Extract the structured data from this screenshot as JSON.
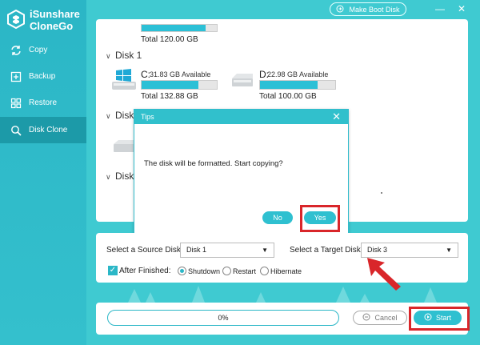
{
  "app": {
    "name_line1": "iSunshare",
    "name_line2": "CloneGo",
    "make_boot_label": "Make Boot Disk",
    "minimize_glyph": "—",
    "close_glyph": "✕"
  },
  "sidebar": {
    "items": [
      {
        "label": "Copy",
        "icon": "sync-icon"
      },
      {
        "label": "Backup",
        "icon": "backup-icon"
      },
      {
        "label": "Restore",
        "icon": "restore-icon"
      },
      {
        "label": "Disk Clone",
        "icon": "disk-clone-icon",
        "active": true
      }
    ]
  },
  "disks": {
    "top_total": "Total 120.00 GB",
    "disk1": {
      "label": "Disk 1",
      "drives": [
        {
          "letter": "C:",
          "available": "31.83 GB Available",
          "total": "Total 132.88 GB",
          "used_fraction": 0.76
        },
        {
          "letter": "D:",
          "available": "22.98 GB Available",
          "total": "Total 100.00 GB",
          "used_fraction": 0.77
        }
      ]
    },
    "disk2_label": "Disk",
    "disk3_label": "Disk"
  },
  "dialog": {
    "title": "Tips",
    "message": "The disk will be formatted. Start copying?",
    "no_label": "No",
    "yes_label": "Yes"
  },
  "selection": {
    "source_label": "Select a Source Disk:",
    "source_value": "Disk 1",
    "target_label": "Select a Target Disk:",
    "target_value": "Disk 3",
    "after_label": "After Finished:",
    "options": [
      {
        "label": "Shutdown",
        "selected": true
      },
      {
        "label": "Restart",
        "selected": false
      },
      {
        "label": "Hibernate",
        "selected": false
      }
    ]
  },
  "progress": {
    "percent_text": "0%",
    "cancel_label": "Cancel",
    "start_label": "Start"
  },
  "colors": {
    "accent": "#2fc0d0",
    "highlight": "#d9262a",
    "sidebar_active": "#1c9aa8"
  }
}
